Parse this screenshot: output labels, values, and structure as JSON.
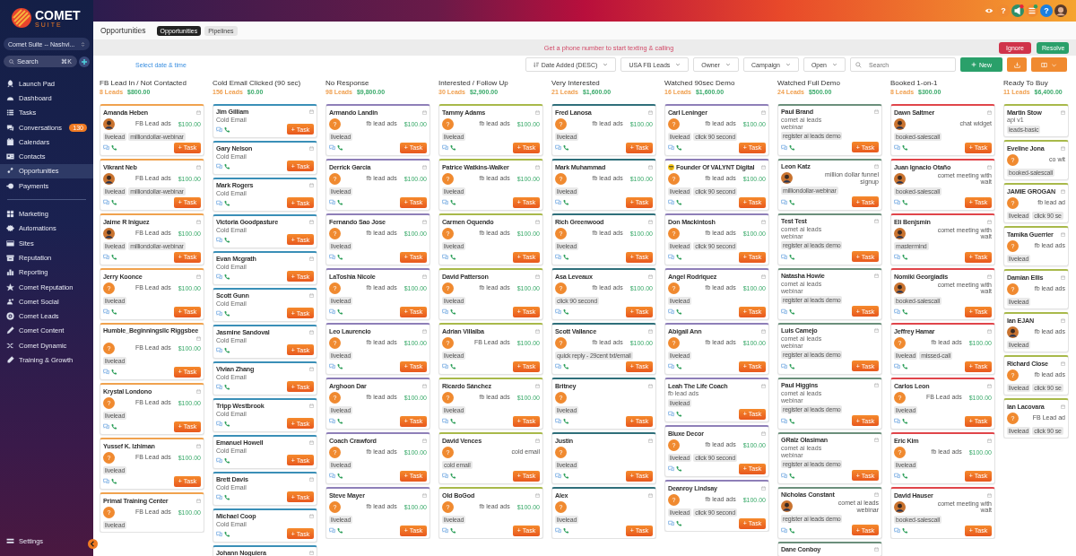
{
  "sidebar": {
    "brand": "COMET",
    "brand_sub": "SUITE",
    "location": "Comet Suite -- Nashvi...",
    "search": {
      "placeholder": "Search",
      "shortcut": "⌘K"
    },
    "sections": [
      {
        "items": [
          {
            "label": "Launch Pad",
            "selected": false
          },
          {
            "label": "Dashboard",
            "selected": false
          },
          {
            "label": "Tasks",
            "selected": false
          },
          {
            "label": "Conversations",
            "selected": false,
            "badge": "130"
          },
          {
            "label": "Calendars",
            "selected": false
          },
          {
            "label": "Contacts",
            "selected": false
          },
          {
            "label": "Opportunities",
            "selected": true
          },
          {
            "label": "Payments",
            "selected": false
          }
        ]
      },
      {
        "items": [
          {
            "label": "Marketing",
            "selected": false
          },
          {
            "label": "Automations",
            "selected": false
          },
          {
            "label": "Sites",
            "selected": false
          },
          {
            "label": "Reputation",
            "selected": false
          },
          {
            "label": "Reporting",
            "selected": false
          },
          {
            "label": "Comet Reputation",
            "selected": false
          },
          {
            "label": "Comet Social",
            "selected": false
          },
          {
            "label": "Comet Leads",
            "selected": false
          },
          {
            "label": "Comet Content",
            "selected": false
          },
          {
            "label": "Comet Dynamic",
            "selected": false
          },
          {
            "label": "Training & Growth",
            "selected": false
          }
        ]
      }
    ],
    "settings": "Settings"
  },
  "header_icons": [
    {
      "kind": "eye"
    },
    {
      "kind": "help",
      "text": "?"
    },
    {
      "kind": "megaphone"
    },
    {
      "kind": "list"
    },
    {
      "kind": "help-blue",
      "text": "?"
    },
    {
      "kind": "avatar"
    }
  ],
  "page": {
    "title": "Opportunities",
    "tabs": [
      {
        "label": "Opportunities",
        "selected": true
      },
      {
        "label": "Pipelines",
        "selected": false
      }
    ]
  },
  "banner": {
    "text": "Get a phone number to start texting & calling",
    "buttons": [
      {
        "label": "Ignore",
        "kind": "danger"
      },
      {
        "label": "Resolve",
        "kind": "success"
      }
    ]
  },
  "filters": {
    "date_link": "Select date & time",
    "dropdowns": [
      {
        "label": "Date Added (DESC)",
        "kind": "sort"
      },
      {
        "label": "USA FB Leads",
        "kind": "plain"
      },
      {
        "label": "Owner",
        "kind": "plain"
      },
      {
        "label": "Campaign",
        "kind": "plain"
      },
      {
        "label": "Open",
        "kind": "plain"
      }
    ],
    "search": {
      "placeholder": "Search"
    },
    "new_button": "New"
  },
  "columns": [
    {
      "title": "FB Lead In / Not Contacted",
      "count": "8 Leads",
      "value": "$800.00",
      "color": "#f0a24e",
      "cards": [
        {
          "name": "Amanda Heben",
          "avatar": {
            "kind": "photo"
          },
          "source": "FB Lead ads",
          "amount": "$100.00",
          "tags": [
            "livelead",
            "milliondollar-webinar"
          ],
          "button": "+ Task"
        },
        {
          "name": "Vikrant Neb",
          "avatar": {
            "kind": "photo"
          },
          "source": "FB Lead ads",
          "amount": "$100.00",
          "tags": [
            "livelead",
            "milliondollar-webinar"
          ],
          "button": "+ Task"
        },
        {
          "name": "Jaime R Iniguez",
          "avatar": {
            "kind": "photo"
          },
          "source": "FB Lead ads",
          "amount": "$100.00",
          "tags": [
            "livelead",
            "milliondollar-webinar"
          ],
          "button": "+ Task"
        },
        {
          "name": "Jerry Koonce",
          "avatar": {
            "kind": "initial",
            "text": "?"
          },
          "source": "FB Lead ads",
          "amount": "$100.00",
          "tags": [
            "livelead"
          ],
          "button": "+ Task"
        },
        {
          "name": "Humble_Beginningsllc Riggsbee",
          "avatar": {
            "kind": "initial",
            "text": "?"
          },
          "source": "FB Lead ads",
          "amount": "$100.00",
          "tags": [
            "livelead"
          ],
          "button": "+ Task"
        },
        {
          "name": "Krystal Londono",
          "avatar": {
            "kind": "initial",
            "text": "?"
          },
          "source": "FB Lead ads",
          "amount": "$100.00",
          "tags": [
            "livelead"
          ],
          "button": "+ Task"
        },
        {
          "name": "Yussef K. Izhiman",
          "avatar": {
            "kind": "initial",
            "text": "?"
          },
          "source": "FB Lead ads",
          "amount": "$100.00",
          "tags": [
            "livelead"
          ],
          "button": "+ Task"
        },
        {
          "name": "Primal Training Center",
          "avatar": {
            "kind": "initial",
            "text": "?"
          },
          "source": "FB Lead ads",
          "amount": "$100.00",
          "tags": [
            "livelead"
          ]
        }
      ]
    },
    {
      "title": "Cold Email Clicked (90 sec)",
      "count": "156 Leads",
      "value": "$0.00",
      "color": "#3a8fb7",
      "cards": [
        {
          "name": "Jim Gilliam",
          "sub": "Cold Email",
          "button": "+ Task"
        },
        {
          "name": "Gary Nelson",
          "sub": "Cold Email",
          "button": "+ Task"
        },
        {
          "name": "Mark Rogers",
          "sub": "Cold Email",
          "button": "+ Task"
        },
        {
          "name": "Victoria Goodpasture",
          "sub": "Cold Email",
          "button": "+ Task"
        },
        {
          "name": "Evan Mcgrath",
          "sub": "Cold Email",
          "button": "+ Task"
        },
        {
          "name": "Scott Gunn",
          "sub": "Cold Email",
          "button": "+ Task"
        },
        {
          "name": "Jasmine Sandoval",
          "sub": "Cold Email",
          "button": "+ Task"
        },
        {
          "name": "Vivian Zhang",
          "sub": "Cold Email",
          "button": "+ Task"
        },
        {
          "name": "Tripp Westbrook",
          "sub": "Cold Email",
          "button": "+ Task"
        },
        {
          "name": "Emanuel Howell",
          "sub": "Cold Email",
          "button": "+ Task"
        },
        {
          "name": "Brett Davis",
          "sub": "Cold Email",
          "button": "+ Task"
        },
        {
          "name": "Michael Coop",
          "sub": "Cold Email",
          "button": "+ Task"
        },
        {
          "name": "Johann Noguiera"
        }
      ]
    },
    {
      "title": "No Response",
      "count": "98 Leads",
      "value": "$9,800.00",
      "color": "#8e7fb8",
      "cards": [
        {
          "name": "Armando Landin",
          "avatar": {
            "kind": "initial",
            "text": "?"
          },
          "source": "fb lead ads",
          "amount": "$100.00",
          "tags": [
            "livelead"
          ],
          "button": "+ Task"
        },
        {
          "name": "Derrick Garcia",
          "avatar": {
            "kind": "initial",
            "text": "?"
          },
          "source": "fb lead ads",
          "amount": "$100.00",
          "tags": [
            "livelead"
          ],
          "button": "+ Task"
        },
        {
          "name": "Fernando Sao Jose",
          "avatar": {
            "kind": "initial",
            "text": "?"
          },
          "source": "fb lead ads",
          "amount": "$100.00",
          "tags": [
            "livelead"
          ],
          "button": "+ Task"
        },
        {
          "name": "LaToshia Nicole",
          "avatar": {
            "kind": "initial",
            "text": "?"
          },
          "source": "fb lead ads",
          "amount": "$100.00",
          "tags": [
            "livelead"
          ],
          "button": "+ Task"
        },
        {
          "name": "Leo Laurencio",
          "avatar": {
            "kind": "initial",
            "text": "?"
          },
          "source": "fb lead ads",
          "amount": "$100.00",
          "tags": [
            "livelead"
          ],
          "button": "+ Task"
        },
        {
          "name": "Arghoon Dar",
          "avatar": {
            "kind": "initial",
            "text": "?"
          },
          "source": "fb lead ads",
          "amount": "$100.00",
          "tags": [
            "livelead"
          ],
          "button": "+ Task"
        },
        {
          "name": "Coach Crawford",
          "avatar": {
            "kind": "initial",
            "text": "?"
          },
          "source": "fb lead ads",
          "amount": "$100.00",
          "tags": [
            "livelead"
          ],
          "button": "+ Task"
        },
        {
          "name": "Steve Mayer",
          "avatar": {
            "kind": "initial",
            "text": "?"
          },
          "source": "fb lead ads",
          "amount": "$100.00",
          "tags": [
            "livelead"
          ],
          "button": "+ Task"
        }
      ]
    },
    {
      "title": "Interested / Follow Up",
      "count": "30 Leads",
      "value": "$2,900.00",
      "color": "#a8b94a",
      "cards": [
        {
          "name": "Tammy Adams",
          "avatar": {
            "kind": "initial",
            "text": "?"
          },
          "source": "fb lead ads",
          "amount": "$100.00",
          "tags": [
            "livelead"
          ],
          "button": "+ Task"
        },
        {
          "name": "Patrice Watkins-Walker",
          "avatar": {
            "kind": "initial",
            "text": "?"
          },
          "source": "fb lead ads",
          "amount": "$100.00",
          "tags": [
            "livelead"
          ],
          "button": "+ Task"
        },
        {
          "name": "Carmen Oquendo",
          "avatar": {
            "kind": "initial",
            "text": "?"
          },
          "source": "fb lead ads",
          "amount": "$100.00",
          "tags": [
            "livelead"
          ],
          "button": "+ Task"
        },
        {
          "name": "David Patterson",
          "avatar": {
            "kind": "initial",
            "text": "?"
          },
          "source": "fb lead ads",
          "amount": "$100.00",
          "tags": [
            "livelead"
          ],
          "button": "+ Task"
        },
        {
          "name": "Adrian Villalba",
          "avatar": {
            "kind": "initial",
            "text": "?"
          },
          "source": "FB Lead ads",
          "amount": "$100.00",
          "tags": [
            "livelead"
          ],
          "button": "+ Task"
        },
        {
          "name": "Ricardo Sánchez",
          "avatar": {
            "kind": "initial",
            "text": "?"
          },
          "source": "fb lead ads",
          "amount": "$100.00",
          "tags": [
            "livelead"
          ],
          "button": "+ Task"
        },
        {
          "name": "David Vences",
          "avatar": {
            "kind": "initial",
            "text": "?"
          },
          "source": "cold email",
          "tags": [
            "cold email"
          ],
          "button": "+ Task"
        },
        {
          "name": "Old BoGod",
          "avatar": {
            "kind": "initial",
            "text": "?"
          },
          "source": "fb lead ads",
          "amount": "$100.00",
          "tags": [
            "livelead"
          ],
          "button": "+ Task"
        }
      ]
    },
    {
      "title": "Very Interested",
      "count": "21 Leads",
      "value": "$1,600.00",
      "color": "#2f6f7a",
      "cards": [
        {
          "name": "Fred Lanosa",
          "avatar": {
            "kind": "initial",
            "text": "?"
          },
          "source": "fb lead ads",
          "amount": "$100.00",
          "tags": [
            "livelead"
          ],
          "button": "+ Task"
        },
        {
          "name": "Mark Muhammad",
          "avatar": {
            "kind": "initial",
            "text": "?"
          },
          "source": "fb lead ads",
          "amount": "$100.00",
          "tags": [
            "livelead"
          ],
          "button": "+ Task"
        },
        {
          "name": "Rich Greenwood",
          "avatar": {
            "kind": "initial",
            "text": "?"
          },
          "source": "fb lead ads",
          "amount": "$100.00",
          "tags": [
            "livelead"
          ],
          "button": "+ Task"
        },
        {
          "name": "Asa Leveaux",
          "avatar": {
            "kind": "initial",
            "text": "?"
          },
          "source": "fb lead ads",
          "amount": "$100.00",
          "tags": [
            "click 90 second"
          ],
          "button": "+ Task"
        },
        {
          "name": "Scott Vallance",
          "avatar": {
            "kind": "initial",
            "text": "?"
          },
          "source": "fb lead ads",
          "amount": "$100.00",
          "tags": [
            "quick reply - 29cent txt/email"
          ],
          "button": "+ Task"
        },
        {
          "name": "Britney",
          "avatar": {
            "kind": "initial",
            "text": "?"
          },
          "tags": [
            "livelead"
          ],
          "button": "+ Task"
        },
        {
          "name": "Justin",
          "avatar": {
            "kind": "initial",
            "text": "?"
          },
          "tags": [
            "livelead"
          ],
          "button": "+ Task"
        },
        {
          "name": "Alex",
          "avatar": {
            "kind": "initial",
            "text": "?"
          },
          "tags": [
            "livelead"
          ],
          "button": "+ Task"
        }
      ]
    },
    {
      "title": "Watched 90sec Demo",
      "count": "16 Leads",
      "value": "$1,600.00",
      "color": "#8e7fb8",
      "cards": [
        {
          "name": "Carl Leninger",
          "avatar": {
            "kind": "initial",
            "text": "?"
          },
          "source": "fb lead ads",
          "amount": "$100.00",
          "tags": [
            "livelead",
            "click 90 second"
          ],
          "button": "+ Task"
        },
        {
          "name": "Founder Of VALYNT Digital",
          "name_icon": {
            "kind": "emoji"
          },
          "avatar": {
            "kind": "initial",
            "text": "?"
          },
          "source": "fb lead ads",
          "amount": "$100.00",
          "tags": [
            "livelead",
            "click 90 second"
          ],
          "button": "+ Task"
        },
        {
          "name": "Don Mackintosh",
          "avatar": {
            "kind": "initial",
            "text": "?"
          },
          "source": "fb lead ads",
          "amount": "$100.00",
          "tags": [
            "livelead",
            "click 90 second"
          ],
          "button": "+ Task"
        },
        {
          "name": "Angel Rodriquez",
          "avatar": {
            "kind": "initial",
            "text": "?"
          },
          "source": "fb lead ads",
          "amount": "$100.00",
          "tags": [
            "livelead"
          ],
          "button": "+ Task"
        },
        {
          "name": "Abigail Ann",
          "avatar": {
            "kind": "initial",
            "text": "?"
          },
          "source": "fb lead ads",
          "amount": "$100.00",
          "tags": [
            "livelead"
          ],
          "button": "+ Task"
        },
        {
          "name": "Leah The Life Coach",
          "sub": "fb lead ads",
          "tags": [
            "livelead"
          ],
          "button": "+ Task"
        },
        {
          "name": "Bluxe Decor",
          "avatar": {
            "kind": "initial",
            "text": "?"
          },
          "source": "fb lead ads",
          "amount": "$100.00",
          "tags": [
            "livelead",
            "click 90 second"
          ],
          "button": "+ Task"
        },
        {
          "name": "Deanroy Lindsay",
          "avatar": {
            "kind": "initial",
            "text": "?"
          },
          "source": "fb lead ads",
          "amount": "$100.00",
          "tags": [
            "livelead",
            "click 90 second"
          ],
          "button": "+ Task"
        }
      ]
    },
    {
      "title": "Watched Full Demo",
      "count": "24 Leads",
      "value": "$500.00",
      "color": "#6b8f7b",
      "cards": [
        {
          "name": "Paul Brand",
          "sub": "comet ai leads webinar",
          "tags": [
            "register ai leads demo"
          ],
          "button": "+ Task"
        },
        {
          "name": "Leon Katz",
          "avatar": {
            "kind": "photo"
          },
          "source": "million dollar funnel signup",
          "tags": [
            "milliondollar-webinar"
          ],
          "button": "+ Task"
        },
        {
          "name": "Test Test",
          "sub": "comet ai leads webinar",
          "tags": [
            "register ai leads demo"
          ],
          "button": "+ Task"
        },
        {
          "name": "Natasha Howie",
          "sub": "comet ai leads webinar",
          "tags": [
            "register ai leads demo"
          ],
          "button": "+ Task"
        },
        {
          "name": "Luis Camejo",
          "sub": "comet ai leads webinar",
          "tags": [
            "register ai leads demo"
          ],
          "button": "+ Task"
        },
        {
          "name": "Paul Higgins",
          "sub": "comet ai leads webinar",
          "tags": [
            "register ai leads demo"
          ],
          "button": "+ Task"
        },
        {
          "name": "GRalz Olasiman",
          "sub": "comet ai leads webinar",
          "tags": [
            "register ai leads demo"
          ],
          "button": "+ Task"
        },
        {
          "name": "Nicholas Constant",
          "avatar": {
            "kind": "photo"
          },
          "source": "comet ai leads webinar",
          "tags": [
            "register ai leads demo"
          ],
          "button": "+ Task"
        },
        {
          "name": "Dane Conboy"
        }
      ]
    },
    {
      "title": "Booked 1-on-1",
      "count": "8 Leads",
      "value": "$300.00",
      "color": "#e0454a",
      "cards": [
        {
          "name": "Dawn Saltmer",
          "avatar": {
            "kind": "photo"
          },
          "source": "chat widget",
          "tags": [
            "booked-salescall"
          ],
          "button": "+ Task"
        },
        {
          "name": "Juan Ignacio Otaño",
          "avatar": {
            "kind": "photo"
          },
          "source": "comet meeting with walt",
          "tags": [
            "booked-salescall"
          ],
          "button": "+ Task"
        },
        {
          "name": "Eli Benjsmin",
          "avatar": {
            "kind": "photo"
          },
          "source": "comet meeting with walt",
          "tags": [
            "mastermind"
          ],
          "button": "+ Task"
        },
        {
          "name": "Nomiki Georgiadis",
          "avatar": {
            "kind": "photo"
          },
          "source": "comet meeting with walt",
          "tags": [
            "booked-salescall"
          ],
          "button": "+ Task"
        },
        {
          "name": "Jeffrey Hamar",
          "avatar": {
            "kind": "initial",
            "text": "?"
          },
          "source": "fb lead ads",
          "amount": "$100.00",
          "tags": [
            "livelead",
            "missed-call"
          ],
          "button": "+ Task"
        },
        {
          "name": "Carlos Leon",
          "avatar": {
            "kind": "initial",
            "text": "?"
          },
          "source": "FB Lead ads",
          "amount": "$100.00",
          "tags": [
            "livelead"
          ],
          "button": "+ Task"
        },
        {
          "name": "Eric Kim",
          "avatar": {
            "kind": "initial",
            "text": "?"
          },
          "source": "fb lead ads",
          "amount": "$100.00",
          "tags": [
            "livelead"
          ],
          "button": "+ Task"
        },
        {
          "name": "David Hauser",
          "avatar": {
            "kind": "photo"
          },
          "source": "comet meeting with walt",
          "tags": [
            "booked-salescall"
          ],
          "button": "+ Task"
        }
      ]
    },
    {
      "title": "Ready To Buy",
      "count": "11 Leads",
      "value": "$6,400.00",
      "color": "#a8b94a",
      "cards": [
        {
          "name": "Martin Stow",
          "sub": "api v1",
          "tags": [
            "leads-basic"
          ]
        },
        {
          "name": "Eveline Jona",
          "avatar": {
            "kind": "initial",
            "text": "?"
          },
          "source": "co wit",
          "tags": [
            "booked-salescall"
          ]
        },
        {
          "name": "JAMIE GROGAN",
          "avatar": {
            "kind": "initial",
            "text": "?"
          },
          "source": "fb lead ad",
          "tags": [
            "livelead",
            "click 90 se"
          ]
        },
        {
          "name": "Tamika Guerrier",
          "avatar": {
            "kind": "initial",
            "text": "?"
          },
          "source": "fb lead ads",
          "tags": [
            "livelead"
          ]
        },
        {
          "name": "Damian Ellis",
          "avatar": {
            "kind": "initial",
            "text": "?"
          },
          "source": "fb lead ads",
          "tags": [
            "livelead"
          ]
        },
        {
          "name": "Ian EJAN",
          "avatar": {
            "kind": "photo"
          },
          "source": "fb lead ads",
          "tags": [
            "livelead"
          ]
        },
        {
          "name": "Richard Close",
          "avatar": {
            "kind": "initial",
            "text": "?"
          },
          "source": "fb lead ads",
          "tags": [
            "livelead",
            "click 90 se"
          ]
        },
        {
          "name": "Ian Lacovara",
          "avatar": {
            "kind": "initial",
            "text": "?"
          },
          "source": "FB Lead ad",
          "tags": [
            "livelead",
            "click 90 se"
          ]
        }
      ]
    }
  ]
}
